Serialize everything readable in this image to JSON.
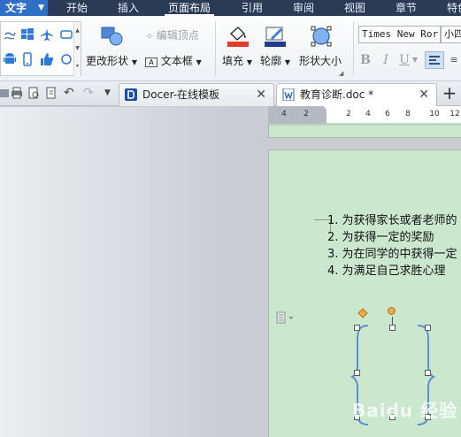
{
  "menubar": {
    "app_label": "文字",
    "items": [
      "开始",
      "插入",
      "页面布局",
      "引用",
      "审阅",
      "视图",
      "章节",
      "特色"
    ],
    "active": "页面布局"
  },
  "ribbon": {
    "edit_vertex": "编辑顶点",
    "change_shape": "更改形状",
    "text_box": "文本框",
    "fill": "填充",
    "outline": "轮廓",
    "shape_size": "形状大小",
    "font_name": "Times New Ror",
    "font_size": "小四",
    "bold": "B",
    "italic": "I",
    "underline": "U"
  },
  "tabs": {
    "docer": "Docer-在线模板",
    "doc": "教育诊断.doc *"
  },
  "ruler": {
    "ticks": [
      "4",
      "2",
      "2",
      "4",
      "6",
      "8",
      "10",
      "12"
    ]
  },
  "document": {
    "items": [
      "1. 为获得家长或者老师的",
      "2. 为获得一定的奖励",
      "3. 为在同学的中获得一定",
      "4. 为满足自己求胜心理"
    ]
  },
  "watermark": "Baidu 经验",
  "colors": {
    "menubar": "#2b3a55",
    "app_button": "#2f6fc7",
    "page_background": "#cbe8cf",
    "handle_orange": "#f0a74a"
  }
}
